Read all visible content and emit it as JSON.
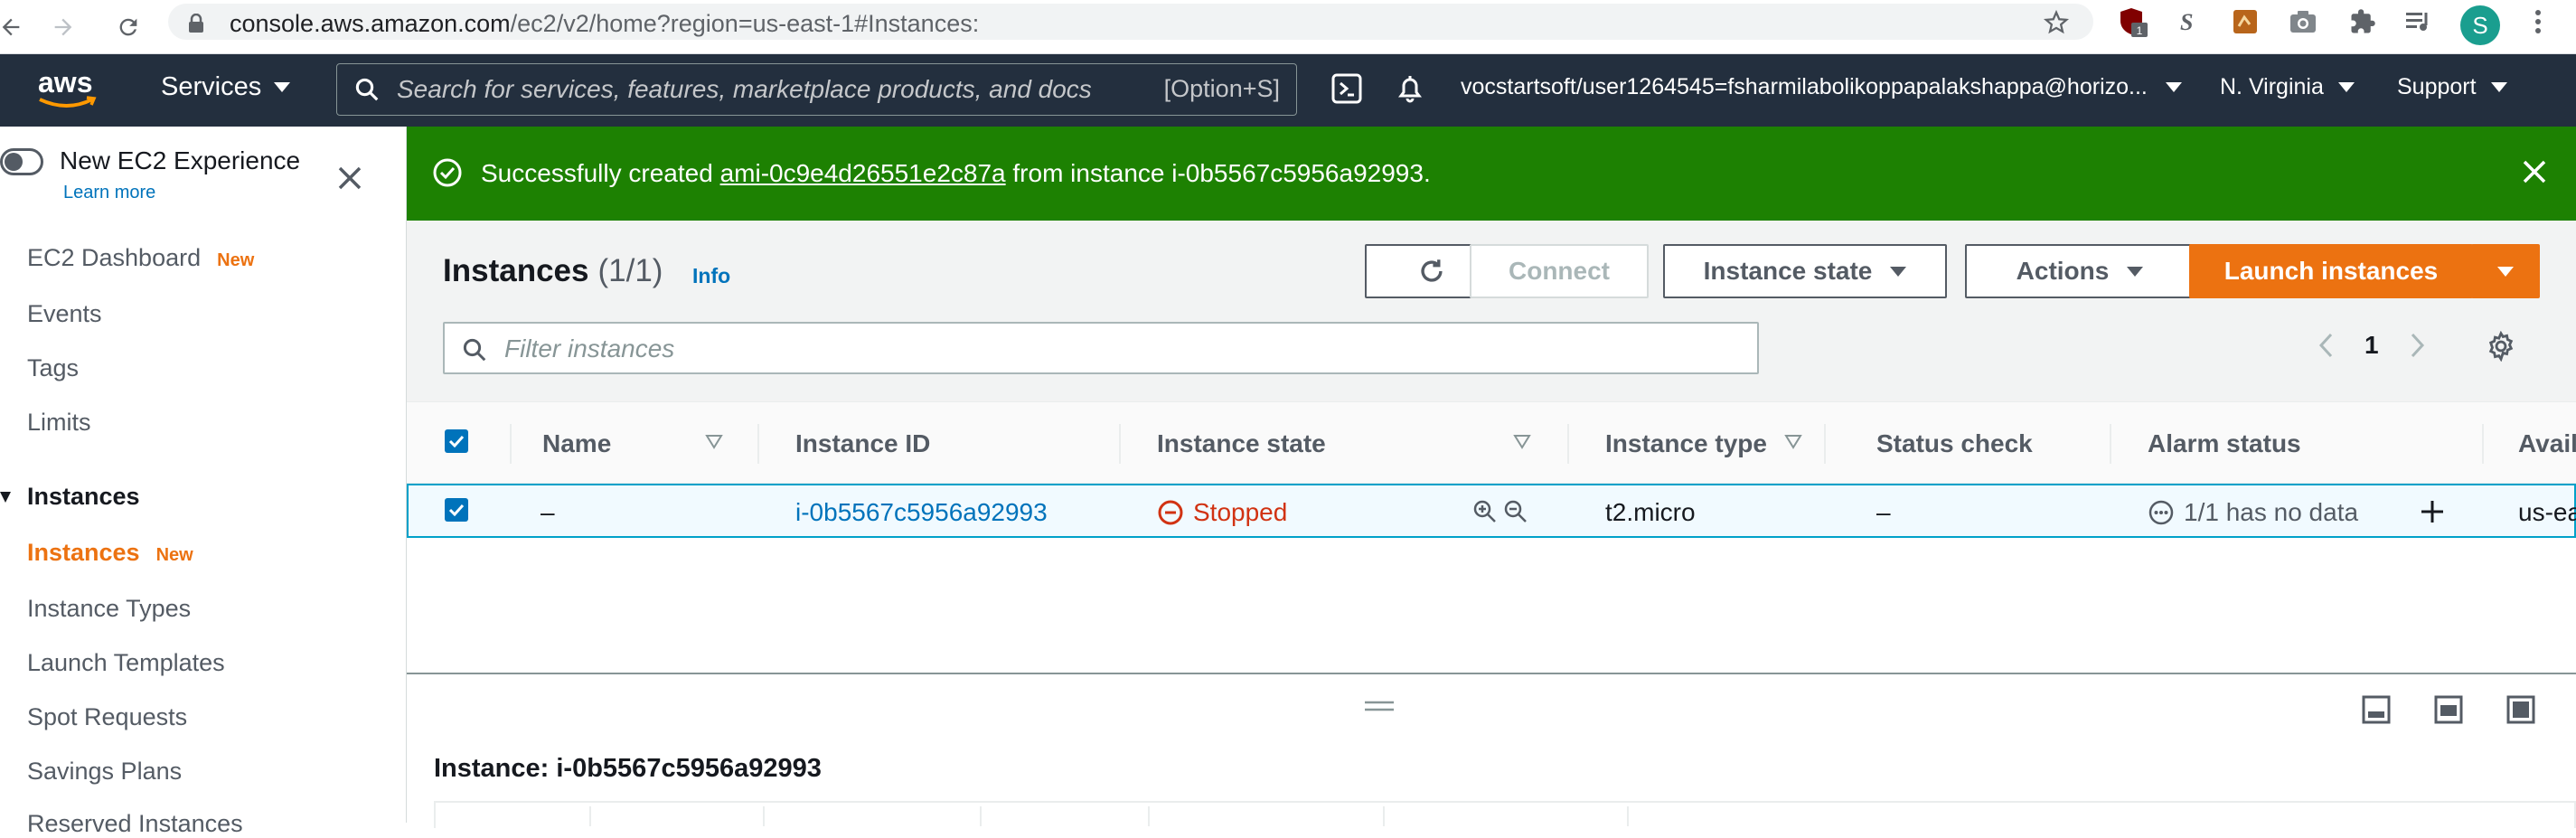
{
  "browser": {
    "url_host": "console.aws.amazon.com",
    "url_path": "/ec2/v2/home?region=us-east-1#Instances:",
    "ublock_badge": "1",
    "profile_initial": "S"
  },
  "aws_nav": {
    "logo": "aws",
    "services_label": "Services",
    "search_placeholder": "Search for services, features, marketplace products, and docs",
    "search_shortcut": "[Option+S]",
    "account": "vocstartsoft/user1264545=fsharmilabolikoppapalakshappa@horizo...",
    "region": "N. Virginia",
    "support": "Support"
  },
  "sidebar": {
    "new_experience": "New EC2 Experience",
    "learn_more": "Learn more",
    "new_tag": "New",
    "items": [
      {
        "label": "EC2 Dashboard",
        "badge": "New"
      },
      {
        "label": "Events"
      },
      {
        "label": "Tags"
      },
      {
        "label": "Limits"
      },
      {
        "label": "Instances",
        "section": true
      },
      {
        "label": "Instances",
        "badge": "New",
        "active": true
      },
      {
        "label": "Instance Types"
      },
      {
        "label": "Launch Templates"
      },
      {
        "label": "Spot Requests"
      },
      {
        "label": "Savings Plans"
      },
      {
        "label": "Reserved Instances"
      }
    ]
  },
  "flash": {
    "prefix": "Successfully created",
    "ami_link": "ami-0c9e4d26551e2c87a",
    "suffix": "from instance i-0b5567c5956a92993.",
    "color": "#1d8102"
  },
  "instances": {
    "title": "Instances",
    "count": "(1/1)",
    "info": "Info",
    "connect": "Connect",
    "instance_state": "Instance state",
    "actions": "Actions",
    "launch": "Launch instances",
    "filter_placeholder": "Filter instances",
    "page": "1",
    "columns": [
      "Name",
      "Instance ID",
      "Instance state",
      "Instance type",
      "Status check",
      "Alarm status",
      "Avail"
    ],
    "row": {
      "name": "–",
      "instance_id": "i-0b5567c5956a92993",
      "state": "Stopped",
      "type": "t2.micro",
      "status_check": "–",
      "alarm": "1/1 has no data",
      "az": "us-ea"
    }
  },
  "details": {
    "title": "Instance: i-0b5567c5956a92993"
  },
  "colors": {
    "aws_nav": "#232f3e",
    "accent": "#ec7211",
    "link": "#0073bb",
    "stopped": "#d13212",
    "success": "#1d8102"
  }
}
